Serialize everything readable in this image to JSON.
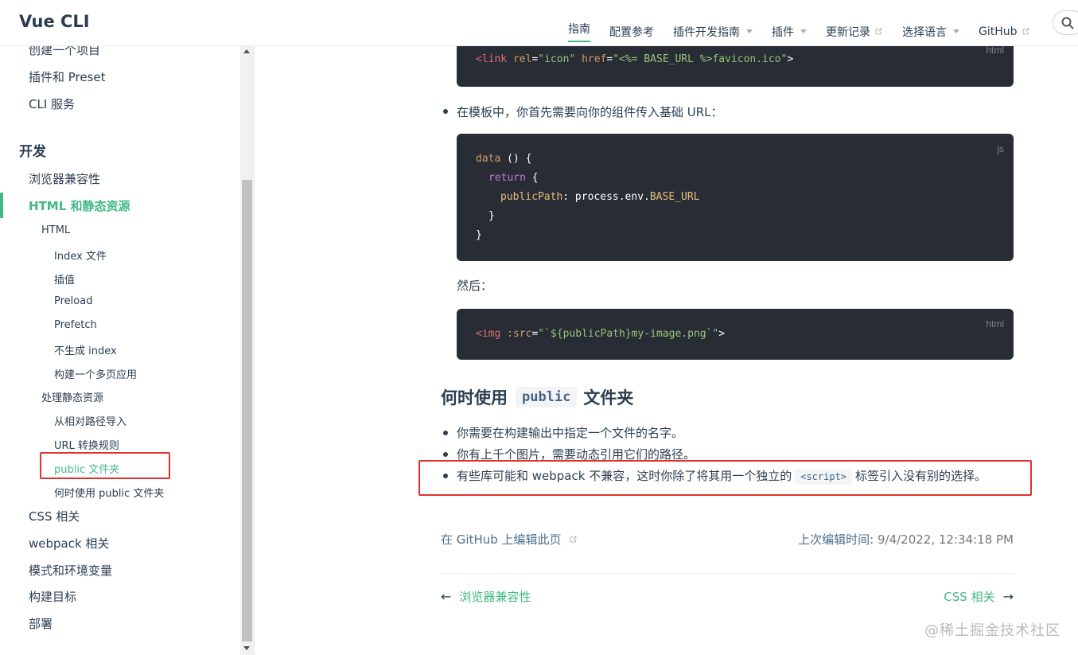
{
  "header": {
    "site_name": "Vue CLI",
    "nav": [
      {
        "label": "指南",
        "active": true,
        "dropdown": false,
        "external": false
      },
      {
        "label": "配置参考",
        "active": false,
        "dropdown": false,
        "external": false
      },
      {
        "label": "插件开发指南",
        "active": false,
        "dropdown": true,
        "external": false
      },
      {
        "label": "插件",
        "active": false,
        "dropdown": true,
        "external": false
      },
      {
        "label": "更新记录",
        "active": false,
        "dropdown": false,
        "external": true
      },
      {
        "label": "选择语言",
        "active": false,
        "dropdown": true,
        "external": false
      },
      {
        "label": "GitHub",
        "active": false,
        "dropdown": false,
        "external": true
      }
    ]
  },
  "sidebar": {
    "top_items": [
      "创建一个项目",
      "插件和 Preset",
      "CLI 服务"
    ],
    "group_title": "开发",
    "items": {
      "browser_compat": "浏览器兼容性",
      "html_static": "HTML 和静态资源",
      "html": "HTML",
      "index_file": "Index 文件",
      "interpolation": "插值",
      "preload": "Preload",
      "prefetch": "Prefetch",
      "no_index": "不生成 index",
      "multipage": "构建一个多页应用",
      "static_assets": "处理静态资源",
      "relative_import": "从相对路径导入",
      "url_rules": "URL 转换规则",
      "public_folder": "public 文件夹",
      "when_public": "何时使用 public 文件夹",
      "css": "CSS 相关",
      "webpack": "webpack 相关",
      "modes_env": "模式和环境变量",
      "build_targets": "构建目标",
      "deploy": "部署"
    }
  },
  "content": {
    "code1": {
      "lang": "html",
      "parts": {
        "open": "<link ",
        "rel_attr": "rel",
        "eq1": "=",
        "rel_val": "\"icon\"",
        "sp": " ",
        "href_attr": "href",
        "eq2": "=",
        "href_val": "\"<%= BASE_URL %>favicon.ico\"",
        "close": ">"
      }
    },
    "para1": "在模板中，你首先需要向你的组件传入基础 URL：",
    "code2": {
      "lang": "js",
      "l1_fn": "data",
      "l1_rest": " () {",
      "l2_kw": "return",
      "l2_rest": " {",
      "l3_prop": "publicPath",
      "l3_mid": ": process.env.",
      "l3_const": "BASE_URL",
      "l4": "}",
      "l5": "}"
    },
    "para2": "然后：",
    "code3": {
      "lang": "html",
      "open": "<img ",
      "attr": ":src",
      "eq": "=",
      "val": "\"`${publicPath}my-image.png`\"",
      "close": ">"
    },
    "h2": {
      "before": "何时使用",
      "code": "public",
      "after": "文件夹"
    },
    "bullets": {
      "b1": "你需要在构建输出中指定一个文件的名字。",
      "b2": "你有上千个图片，需要动态引用它们的路径。",
      "b3_before": "有些库可能和 webpack 不兼容，这时你除了将其用一个独立的",
      "b3_code": "<script>",
      "b3_after": "标签引入没有别的选择。"
    },
    "edit_link": "在 GitHub 上编辑此页",
    "last_updated_label": "上次编辑时间:",
    "last_updated_value": "9/4/2022, 12:34:18 PM",
    "prev": "浏览器兼容性",
    "next": "CSS 相关",
    "prev_arrow": "←",
    "next_arrow": "→"
  },
  "watermark": "@稀土掘金技术社区",
  "colors": {
    "accent": "#42b983",
    "highlight_box": "#e0312d",
    "code_bg": "#282c34"
  }
}
